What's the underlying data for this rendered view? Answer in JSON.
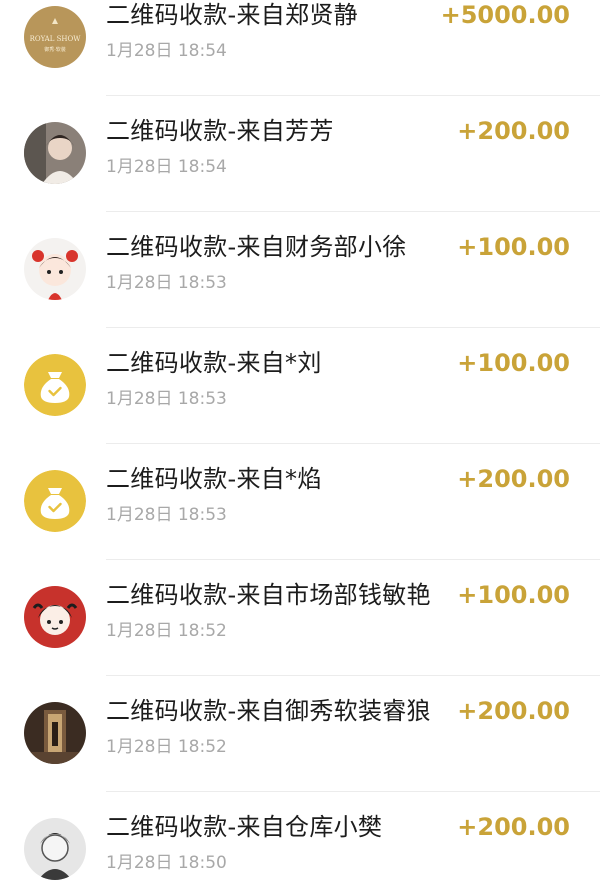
{
  "transactions": [
    {
      "title": "二维码收款-来自郑贤静",
      "time": "1月28日 18:54",
      "amount": "+5000.00",
      "avatar": "royalshow-logo",
      "logo_text": "ROYAL SHOW",
      "logo_sub": "御秀·软装"
    },
    {
      "title": "二维码收款-来自芳芳",
      "time": "1月28日 18:54",
      "amount": "+200.00",
      "avatar": "photo-woman"
    },
    {
      "title": "二维码收款-来自财务部小徐",
      "time": "1月28日 18:53",
      "amount": "+100.00",
      "avatar": "cartoon-girl-red-bows"
    },
    {
      "title": "二维码收款-来自*刘",
      "time": "1月28日 18:53",
      "amount": "+100.00",
      "avatar": "money-bag-icon"
    },
    {
      "title": "二维码收款-来自*焰",
      "time": "1月28日 18:53",
      "amount": "+200.00",
      "avatar": "money-bag-icon"
    },
    {
      "title": "二维码收款-来自市场部钱敏艳",
      "time": "1月28日 18:52",
      "amount": "+100.00",
      "avatar": "cartoon-girl-red-bg"
    },
    {
      "title": "二维码收款-来自御秀软装睿狼",
      "time": "1月28日 18:52",
      "amount": "+200.00",
      "avatar": "photo-interior"
    },
    {
      "title": "二维码收款-来自仓库小樊",
      "time": "1月28日 18:50",
      "amount": "+200.00",
      "avatar": "photo-person-bw"
    }
  ],
  "colors": {
    "amount": "#c9a338",
    "money_bag": "#e8c23e",
    "logo_gold": "#b8965a"
  }
}
